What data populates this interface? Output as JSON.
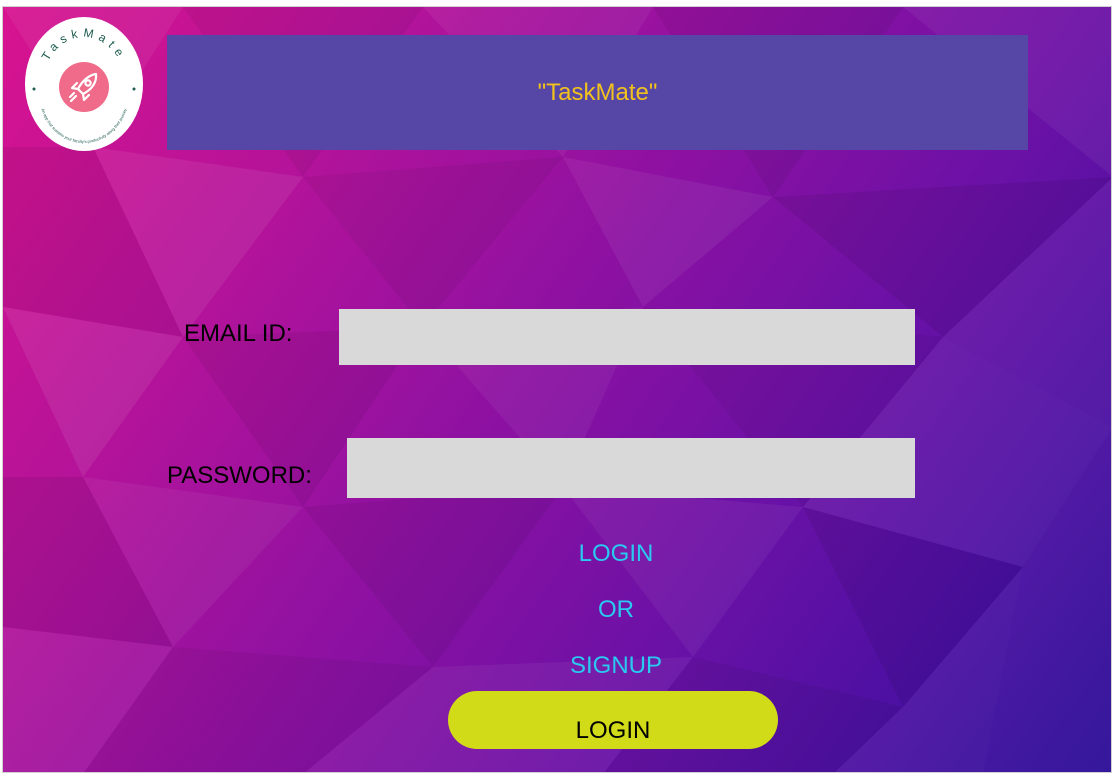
{
  "logo": {
    "arc_text": "TaskMate",
    "tagline": "An app that sustains your faculty's productivity along their journey",
    "icon": "rocket-icon",
    "colors": {
      "circle": "#f06a8a",
      "text": "#1d5c4f"
    }
  },
  "header": {
    "title": "\"TaskMate\""
  },
  "form": {
    "email_label": "EMAIL ID:",
    "email_value": "",
    "password_label": "PASSWORD:",
    "password_value": ""
  },
  "links": {
    "login": "LOGIN",
    "or": "OR",
    "signup": "SIGNUP"
  },
  "login_button": "LOGIN",
  "colors": {
    "header_bg": "#5646a6",
    "title": "#f2c21c",
    "link": "#29c9f0",
    "button": "#d2db17",
    "field": "#d9d9d9"
  }
}
